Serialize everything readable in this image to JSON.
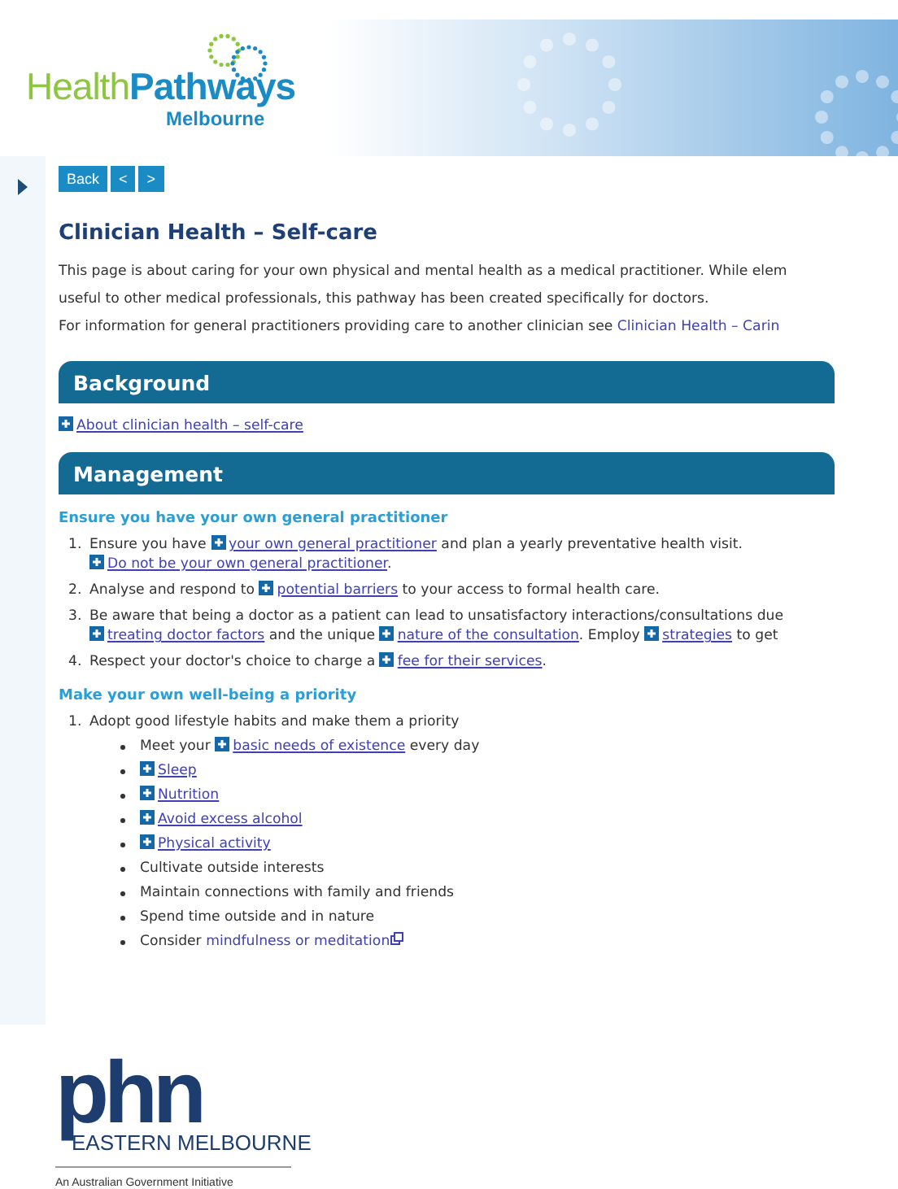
{
  "logo": {
    "word_1": "Health",
    "word_2": "Pathways",
    "region": "Melbourne"
  },
  "nav": {
    "buttons": [
      {
        "label": "Back"
      },
      {
        "label": "<"
      },
      {
        "label": ">"
      }
    ]
  },
  "title": "Clinician Health – Self-care",
  "intro": [
    [
      {
        "kind": "text",
        "text": "This page is about caring for your own physical and mental health as a medical practitioner. While elem"
      }
    ],
    [
      {
        "kind": "text",
        "text": "useful to other medical professionals, this pathway has been created specifically for doctors."
      }
    ],
    [
      {
        "kind": "text",
        "text": "For information for general practitioners providing care to another clinician see "
      },
      {
        "kind": "plainlink",
        "text": "Clinician Health – Carin"
      }
    ]
  ],
  "sections": [
    {
      "heading": "Background",
      "blocks": [
        {
          "kind": "line",
          "lines": [
            [
              {
                "kind": "expand",
                "text": "About clinician health – self-care"
              }
            ]
          ]
        }
      ]
    },
    {
      "heading": "Management",
      "blocks": [
        {
          "kind": "subheading",
          "text": "Ensure you have your own general practitioner"
        },
        {
          "kind": "ordered",
          "items": [
            {
              "number": "1.",
              "lines": [
                [
                  {
                    "kind": "text",
                    "text": "Ensure you have "
                  },
                  {
                    "kind": "expand",
                    "text": "your own general practitioner"
                  },
                  {
                    "kind": "text",
                    "text": " and plan a yearly preventative health visit."
                  }
                ],
                [
                  {
                    "kind": "expand",
                    "text": "Do not be your own general practitioner"
                  },
                  {
                    "kind": "text",
                    "text": "."
                  }
                ]
              ]
            },
            {
              "number": "2.",
              "lines": [
                [
                  {
                    "kind": "text",
                    "text": "Analyse and respond to "
                  },
                  {
                    "kind": "expand",
                    "text": "potential barriers"
                  },
                  {
                    "kind": "text",
                    "text": " to your access to formal health care."
                  }
                ]
              ]
            },
            {
              "number": "3.",
              "lines": [
                [
                  {
                    "kind": "text",
                    "text": "Be aware that being a doctor as a patient can lead to unsatisfactory interactions/consultations due"
                  }
                ],
                [
                  {
                    "kind": "expand",
                    "text": "treating doctor factors"
                  },
                  {
                    "kind": "text",
                    "text": " and the unique "
                  },
                  {
                    "kind": "expand",
                    "text": "nature of the consultation"
                  },
                  {
                    "kind": "text",
                    "text": ". Employ "
                  },
                  {
                    "kind": "expand",
                    "text": "strategies"
                  },
                  {
                    "kind": "text",
                    "text": " to get"
                  }
                ]
              ]
            },
            {
              "number": "4.",
              "lines": [
                [
                  {
                    "kind": "text",
                    "text": "Respect your doctor's choice to charge a "
                  },
                  {
                    "kind": "expand",
                    "text": "fee for their services"
                  },
                  {
                    "kind": "text",
                    "text": "."
                  }
                ]
              ]
            }
          ]
        },
        {
          "kind": "subheading",
          "text": "Make your own well-being a priority"
        },
        {
          "kind": "ordered",
          "items": [
            {
              "number": "1.",
              "lines": [
                [
                  {
                    "kind": "text",
                    "text": "Adopt good lifestyle habits and make them a priority"
                  }
                ]
              ],
              "bullets": [
                [
                  {
                    "kind": "text",
                    "text": "Meet your "
                  },
                  {
                    "kind": "expand",
                    "text": "basic needs of existence"
                  },
                  {
                    "kind": "text",
                    "text": " every day"
                  }
                ],
                [
                  {
                    "kind": "expand",
                    "text": "Sleep"
                  }
                ],
                [
                  {
                    "kind": "expand",
                    "text": "Nutrition"
                  }
                ],
                [
                  {
                    "kind": "expand",
                    "text": "Avoid excess alcohol"
                  }
                ],
                [
                  {
                    "kind": "expand",
                    "text": "Physical activity"
                  }
                ],
                [
                  {
                    "kind": "text",
                    "text": "Cultivate outside interests"
                  }
                ],
                [
                  {
                    "kind": "text",
                    "text": "Maintain connections with family and friends"
                  }
                ],
                [
                  {
                    "kind": "text",
                    "text": "Spend time outside and in nature"
                  }
                ],
                [
                  {
                    "kind": "text",
                    "text": "Consider "
                  },
                  {
                    "kind": "external",
                    "text": "mindfulness or meditation"
                  }
                ]
              ]
            }
          ]
        }
      ]
    }
  ],
  "footer": {
    "logo": "phn",
    "region": "EASTERN MELBOURNE",
    "initiative": "An Australian Government Initiative"
  }
}
